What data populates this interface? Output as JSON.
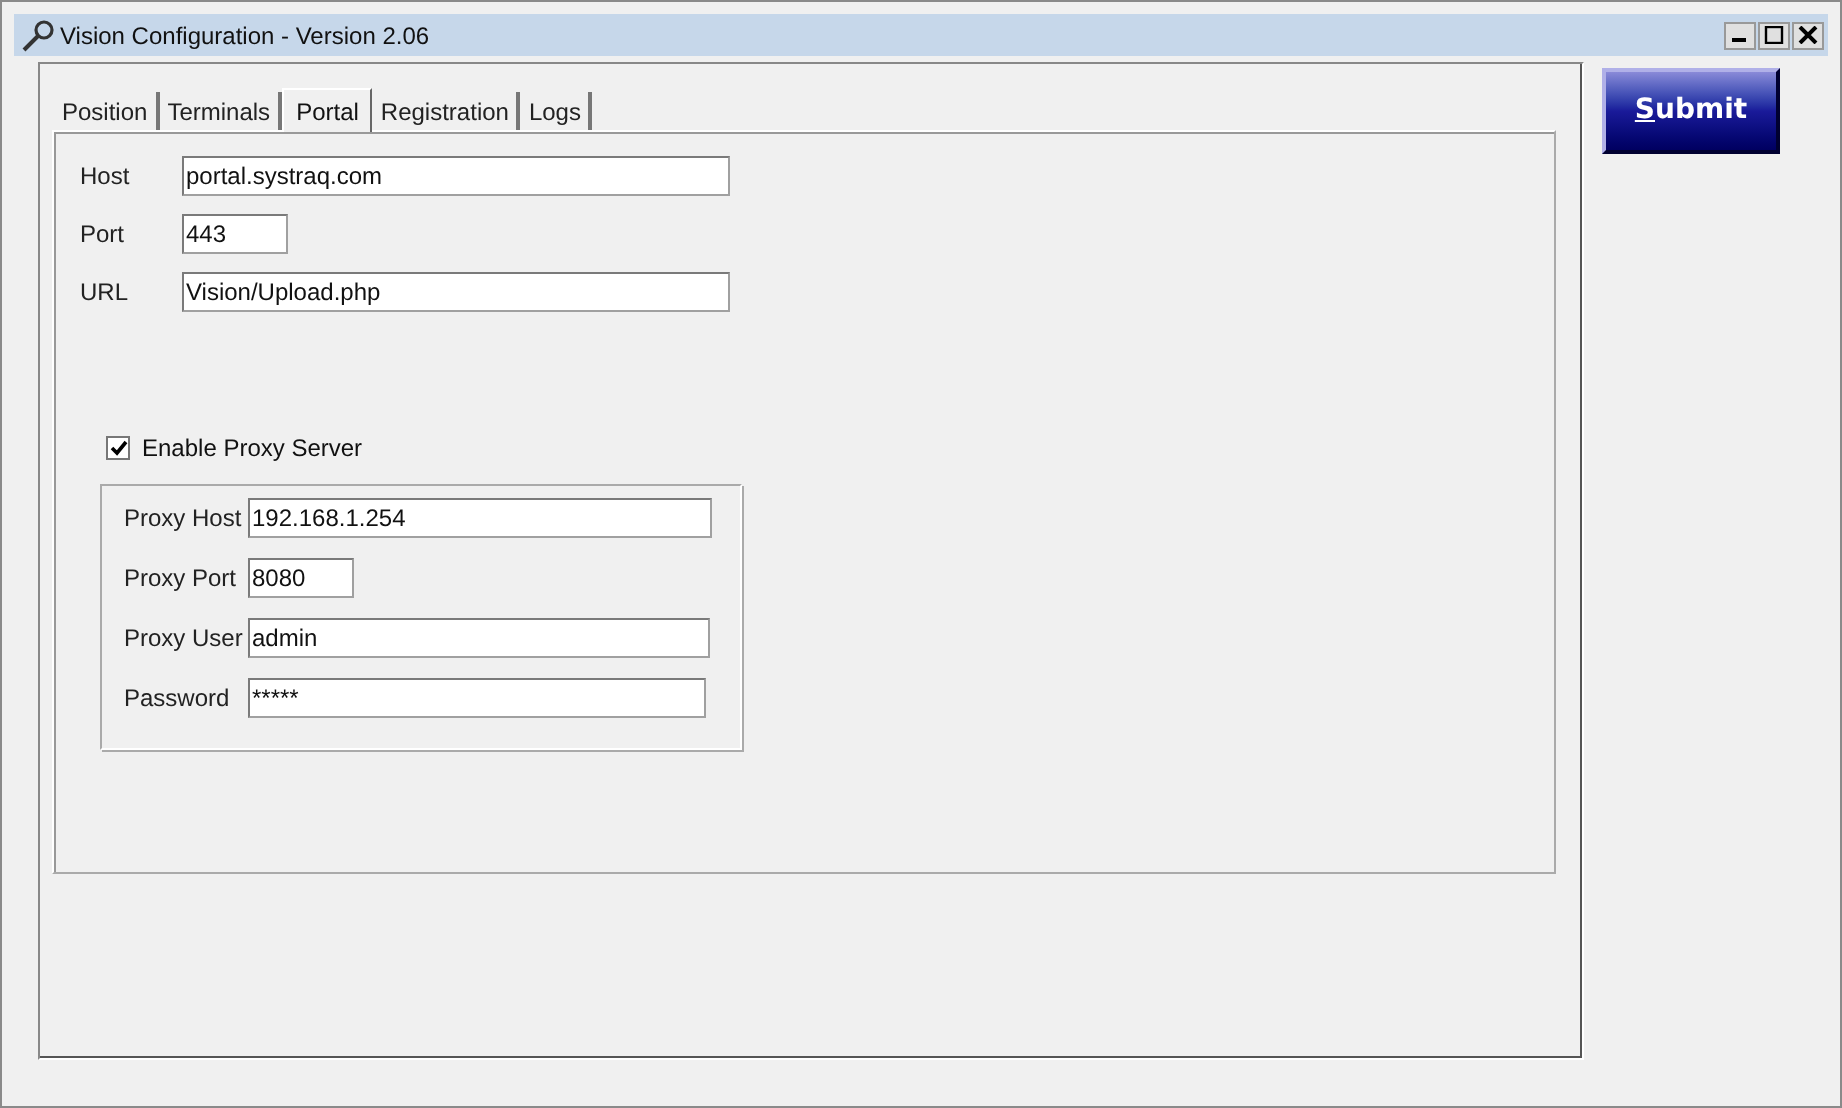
{
  "window": {
    "title": "Vision Configuration - Version 2.06"
  },
  "tabs": [
    {
      "label": "Position",
      "selected": false
    },
    {
      "label": "Terminals",
      "selected": false
    },
    {
      "label": "Portal",
      "selected": true
    },
    {
      "label": "Registration",
      "selected": false
    },
    {
      "label": "Logs",
      "selected": false
    }
  ],
  "portal_fields": [
    {
      "label": "Host",
      "value": "portal.systraq.com"
    },
    {
      "label": "Port",
      "value": "443"
    },
    {
      "label": "URL",
      "value": "Vision/Upload.php"
    }
  ],
  "proxy": {
    "label": "Enable Proxy Server",
    "checked": true,
    "fields": [
      {
        "label": "Proxy Host",
        "value": "192.168.1.254"
      },
      {
        "label": "Proxy Port",
        "value": "8080"
      },
      {
        "label": "Proxy User",
        "value": "admin"
      },
      {
        "label": "Password",
        "value": "*****"
      }
    ]
  },
  "submit_button": {
    "label": "Submit"
  }
}
